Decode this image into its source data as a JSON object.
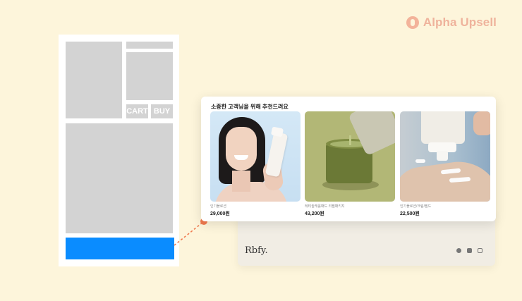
{
  "brand": {
    "name": "Alpha Upsell",
    "icon": "alpha-upsell-logo-icon",
    "color": "#efb39c"
  },
  "wireframe": {
    "cart_label": "CART",
    "buy_label": "BUY",
    "banner_color": "#0a8cff"
  },
  "recommendation": {
    "title": "소중한 고객님을 위해 추천드려요",
    "products": [
      {
        "name": "인기플로션",
        "price": "29,000원",
        "image": "woman-holding-tube-image"
      },
      {
        "name": "레티놀캐롤패드 리필패키지",
        "price": "43,200원",
        "image": "green-jar-pads-image"
      },
      {
        "name": "인기플로션/크림/필드",
        "price": "22,500원",
        "image": "cream-pump-bottle-image"
      }
    ]
  },
  "footer": {
    "logo": "Rbfy.",
    "social_icons": [
      "chat-icon",
      "youtube-icon",
      "instagram-icon"
    ]
  },
  "connector_color": "#f07a4f"
}
